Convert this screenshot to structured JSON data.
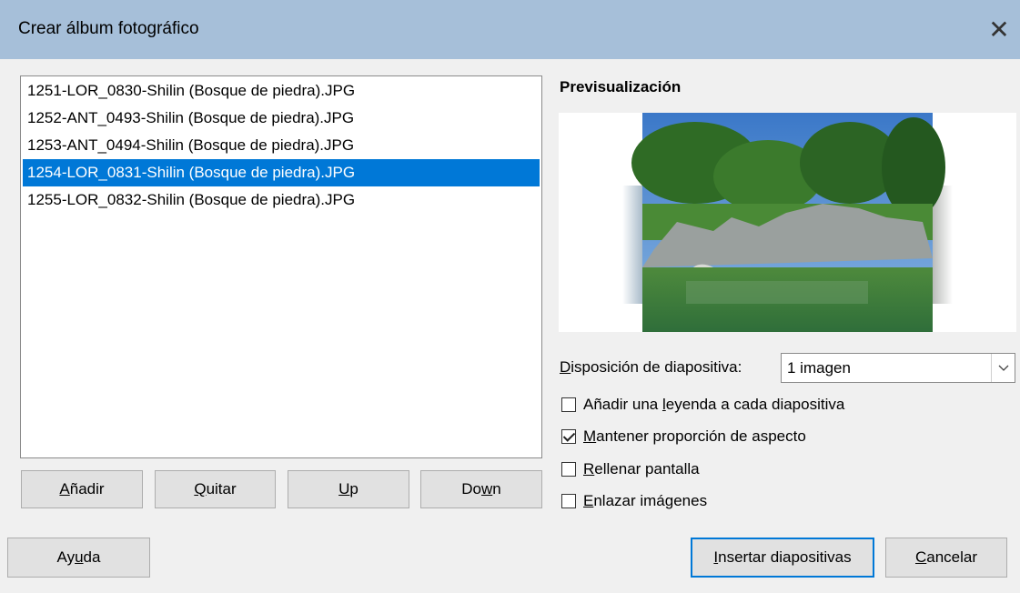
{
  "window": {
    "title": "Crear álbum fotográfico",
    "close_glyph": "✕"
  },
  "file_list": {
    "items": [
      "1251-LOR_0830-Shilin (Bosque de piedra).JPG",
      "1252-ANT_0493-Shilin (Bosque de piedra).JPG",
      "1253-ANT_0494-Shilin (Bosque de piedra).JPG",
      "1254-LOR_0831-Shilin (Bosque de piedra).JPG",
      "1255-LOR_0832-Shilin (Bosque de piedra).JPG"
    ],
    "selected_index": 3
  },
  "list_buttons": {
    "add": {
      "pre": "",
      "u": "A",
      "post": "ñadir"
    },
    "remove": {
      "pre": "",
      "u": "Q",
      "post": "uitar"
    },
    "up": {
      "pre": "",
      "u": "U",
      "post": "p"
    },
    "down": {
      "pre": "Do",
      "u": "w",
      "post": "n"
    }
  },
  "preview": {
    "label": "Previsualización"
  },
  "layout": {
    "label": {
      "pre": "",
      "u": "D",
      "post": "isposición de diapositiva:"
    },
    "value": "1 imagen"
  },
  "options": [
    {
      "pre": "Añadir una ",
      "u": "l",
      "post": "eyenda a cada diapositiva",
      "checked": false
    },
    {
      "pre": "",
      "u": "M",
      "post": "antener proporción de aspecto",
      "checked": true
    },
    {
      "pre": "",
      "u": "R",
      "post": "ellenar pantalla",
      "checked": false
    },
    {
      "pre": "",
      "u": "E",
      "post": "nlazar imágenes",
      "checked": false
    }
  ],
  "footer": {
    "help": {
      "pre": "Ay",
      "u": "u",
      "post": "da"
    },
    "insert": {
      "pre": "",
      "u": "I",
      "post": "nsertar diapositivas"
    },
    "cancel": {
      "pre": "",
      "u": "C",
      "post": "ancelar"
    }
  },
  "colors": {
    "titlebar": "#a6bfd9",
    "selection": "#0078d7",
    "dialog_bg": "#f0f0f0"
  }
}
